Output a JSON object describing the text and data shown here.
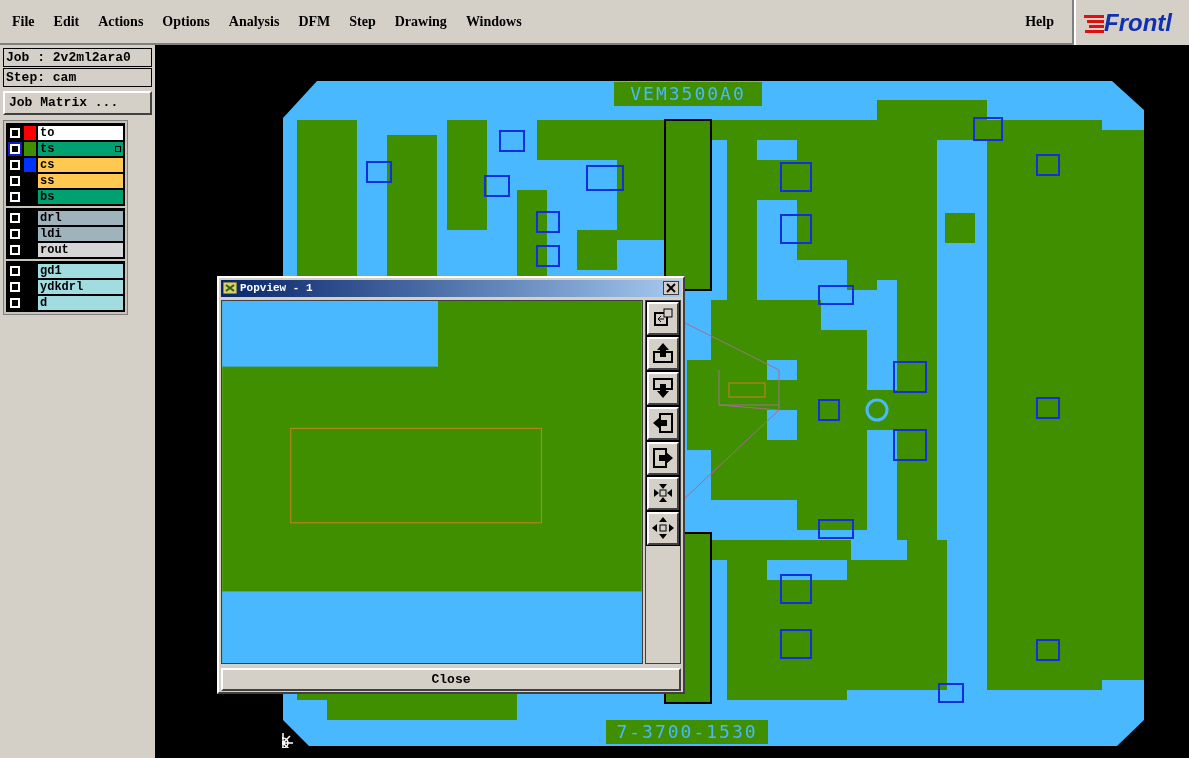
{
  "menu": [
    {
      "label": "File"
    },
    {
      "label": "Edit"
    },
    {
      "label": "Actions"
    },
    {
      "label": "Options"
    },
    {
      "label": "Analysis"
    },
    {
      "label": "DFM"
    },
    {
      "label": "Step"
    },
    {
      "label": "Drawing"
    },
    {
      "label": "Windows"
    }
  ],
  "help": "Help",
  "logo": "Frontl",
  "job": "Job : 2v2ml2ara0",
  "step": "Step: cam",
  "job_matrix_button": "Job Matrix ...",
  "layer_groups": [
    {
      "layers": [
        {
          "name": "to",
          "kind": "silk",
          "color": "#ff0000",
          "checked": false,
          "selected": false
        },
        {
          "name": "ts",
          "kind": "mask",
          "color": "#3f8f00",
          "checked": false,
          "selected": true
        },
        {
          "name": "cs",
          "kind": "signal",
          "color": "#0033ff",
          "checked": false,
          "selected": false
        },
        {
          "name": "ss",
          "kind": "signal",
          "checked": false,
          "selected": false
        },
        {
          "name": "bs",
          "kind": "mask",
          "checked": false,
          "selected": false
        }
      ]
    },
    {
      "layers": [
        {
          "name": "drl",
          "kind": "drill",
          "checked": false,
          "selected": false
        },
        {
          "name": "ldi",
          "kind": "drill",
          "checked": false,
          "selected": false
        },
        {
          "name": "rout",
          "kind": "rout",
          "checked": false,
          "selected": false
        }
      ]
    },
    {
      "layers": [
        {
          "name": "gd1",
          "kind": "misc",
          "checked": false,
          "selected": false
        },
        {
          "name": "ydkdrl",
          "kind": "misc",
          "checked": false,
          "selected": false
        },
        {
          "name": "d",
          "kind": "misc",
          "checked": false,
          "selected": false
        }
      ]
    }
  ],
  "board": {
    "top_label": "VEM3500A0",
    "bottom_label": "7-3700-1530"
  },
  "popview": {
    "title": "Popview - 1",
    "tools": [
      {
        "kind": "window"
      },
      {
        "kind": "pan_up"
      },
      {
        "kind": "pan_down"
      },
      {
        "kind": "pan_left"
      },
      {
        "kind": "pan_right"
      },
      {
        "kind": "shrink"
      },
      {
        "kind": "expand"
      }
    ],
    "close": "Close"
  }
}
